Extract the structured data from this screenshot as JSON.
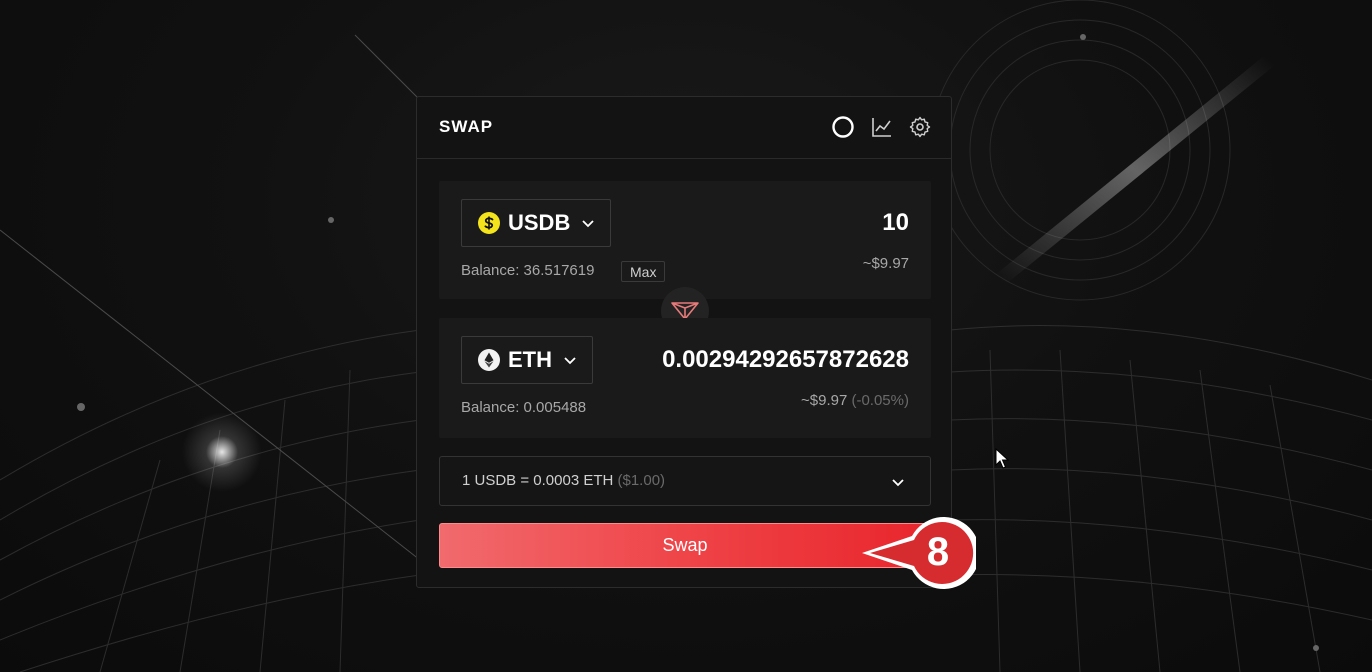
{
  "app": {
    "title": "SWAP"
  },
  "header_icons": [
    "circle-icon",
    "chart-icon",
    "gear-icon"
  ],
  "from_token": {
    "symbol": "USDB",
    "icon": "usdb-icon",
    "balance_label": "Balance: 36.517619",
    "max_label": "Max",
    "amount": "10",
    "usd_value": "~$9.97"
  },
  "to_token": {
    "symbol": "ETH",
    "icon": "eth-icon",
    "balance_label": "Balance: 0.005488",
    "amount": "0.00294292657872628",
    "usd_value": "~$9.97",
    "usd_change": "(-0.05%)"
  },
  "rate": {
    "text": "1 USDB = 0.0003 ETH",
    "usd": "($1.00)"
  },
  "swap_button": {
    "label": "Swap"
  },
  "step_marker": {
    "number": "8"
  },
  "colors": {
    "accent": "#ef4448",
    "usdb_yellow": "#f4e41c",
    "background": "#0e0e0e",
    "card": "#131313"
  }
}
